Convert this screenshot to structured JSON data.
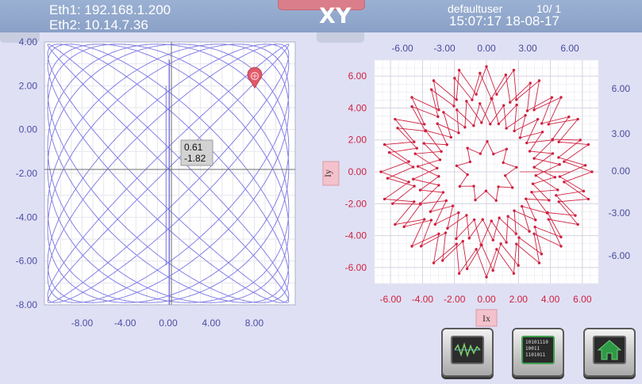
{
  "header": {
    "eth1": "Eth1: 192.168.1.200",
    "eth2": "Eth2: 10.14.7.36",
    "title": "XY",
    "user": "defaultuser",
    "page": "10/ 1",
    "clock": "15:07:17 18-08-17"
  },
  "left_plot": {
    "y_ticks": [
      "4.00",
      "2.00",
      "0.00",
      "-2.00",
      "-4.00",
      "-6.00",
      "-8.00"
    ],
    "x_ticks": [
      "-8.00",
      "-4.00",
      "0.00",
      "4.00",
      "8.00"
    ],
    "cursor_x": "0.61",
    "cursor_y": "-1.82",
    "trace_color": "#6a66e0",
    "marker_color": "#e05a6a"
  },
  "right_plot": {
    "left_y_ticks": [
      "6.00",
      "4.00",
      "2.00",
      "0.00",
      "-2.00",
      "-4.00",
      "-6.00"
    ],
    "right_y_ticks": [
      "6.00",
      "3.00",
      "0.00",
      "-3.00",
      "-6.00"
    ],
    "top_x_ticks": [
      "-6.00",
      "-3.00",
      "0.00",
      "3.00",
      "6.00"
    ],
    "bottom_x_ticks": [
      "-6.00",
      "-4.00",
      "-2.00",
      "0.00",
      "2.00",
      "4.00",
      "6.00"
    ],
    "y_axis_label": "Iy",
    "x_axis_label": "Ix",
    "trace_color": "#d0203f",
    "label_color": "#d0203f",
    "right_label_color": "#4a4a9a"
  },
  "buttons": [
    {
      "icon": "waveform-icon"
    },
    {
      "icon": "binary-data-icon",
      "text_lines": [
        "10101110",
        "10011",
        "1101011"
      ]
    },
    {
      "icon": "home-icon"
    }
  ]
}
